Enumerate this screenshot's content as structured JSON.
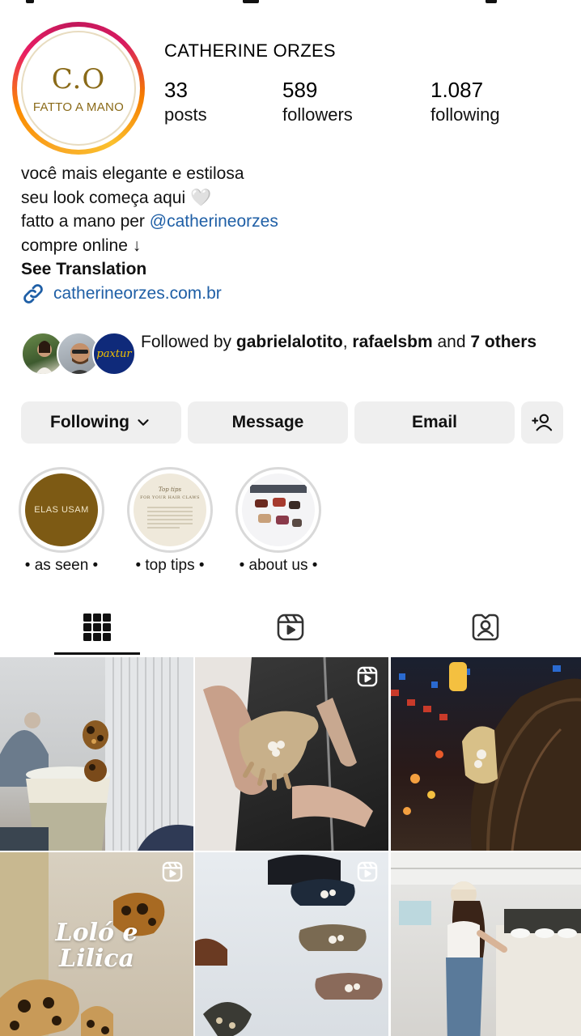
{
  "profile": {
    "avatar_monogram": "C.O",
    "avatar_subtitle": "FATTO A MANO",
    "username": "CATHERINE ORZES"
  },
  "stats": [
    {
      "value": "33",
      "label": "posts"
    },
    {
      "value": "589",
      "label": "followers"
    },
    {
      "value": "1.087",
      "label": "following"
    }
  ],
  "bio": {
    "line1": "você mais elegante e estilosa",
    "line2": "seu look começa aqui 🤍",
    "line3_prefix": "fatto a mano per ",
    "line3_mention": "@catherineorzes",
    "line4": "compre online ↓",
    "see_translation": "See Translation",
    "link": "catherineorzes.com.br"
  },
  "followed_by": {
    "prefix": "Followed by ",
    "user1": "gabrielalotito",
    "sep": ", ",
    "user2": "rafaelsbm",
    "and": " and ",
    "others": "7 others",
    "third_avatar_text": "paxtur"
  },
  "actions": {
    "following": "Following",
    "message": "Message",
    "email": "Email"
  },
  "highlights": [
    {
      "cover_text": "ELAS USAM",
      "caption": "• as seen •"
    },
    {
      "cover_title": "Top tips",
      "cover_text": "FOR YOUR HAIR CLAWS",
      "caption": "• top tips •"
    },
    {
      "caption": "• about us •"
    }
  ],
  "grid": {
    "post4_text_line1": "Loló e",
    "post4_text_line2": "Lilica"
  },
  "colors": {
    "link": "#1f5fa6",
    "button_bg": "#efefef",
    "brand_gold": "#8a6a18"
  }
}
